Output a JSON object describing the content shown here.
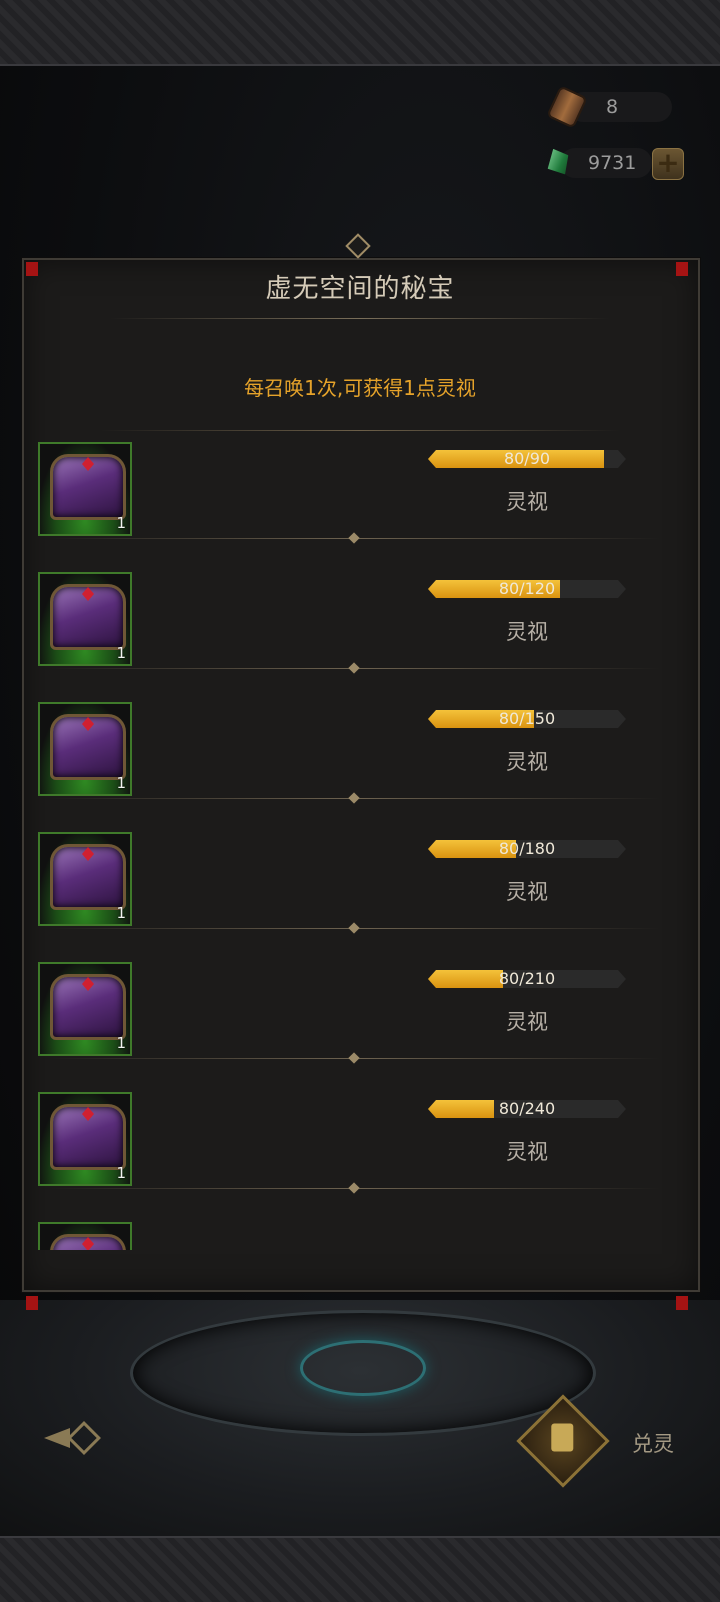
{
  "currency": {
    "scroll": {
      "icon": "scroll-icon",
      "value": "8"
    },
    "gem": {
      "icon": "green-gem-icon",
      "value": "9731"
    },
    "add_icon": "plus-icon"
  },
  "panel": {
    "title": "虚无空间的秘宝",
    "subtitle": "每召唤1次,可获得1点灵视"
  },
  "rewards": [
    {
      "count": "1",
      "progress_text": "80/90",
      "progress": 0.889,
      "label": "灵视"
    },
    {
      "count": "1",
      "progress_text": "80/120",
      "progress": 0.667,
      "label": "灵视"
    },
    {
      "count": "1",
      "progress_text": "80/150",
      "progress": 0.533,
      "label": "灵视"
    },
    {
      "count": "1",
      "progress_text": "80/180",
      "progress": 0.444,
      "label": "灵视"
    },
    {
      "count": "1",
      "progress_text": "80/210",
      "progress": 0.381,
      "label": "灵视"
    },
    {
      "count": "1",
      "progress_text": "80/240",
      "progress": 0.333,
      "label": "灵视"
    }
  ],
  "footer": {
    "exchange_label": "兑灵"
  },
  "colors": {
    "accent": "#e6a32a",
    "bar_fill": "#f4c23a",
    "panel_bg": "#1c1b1a",
    "chest_purple": "#5a2d7a",
    "slot_green": "#3f7a2a"
  }
}
